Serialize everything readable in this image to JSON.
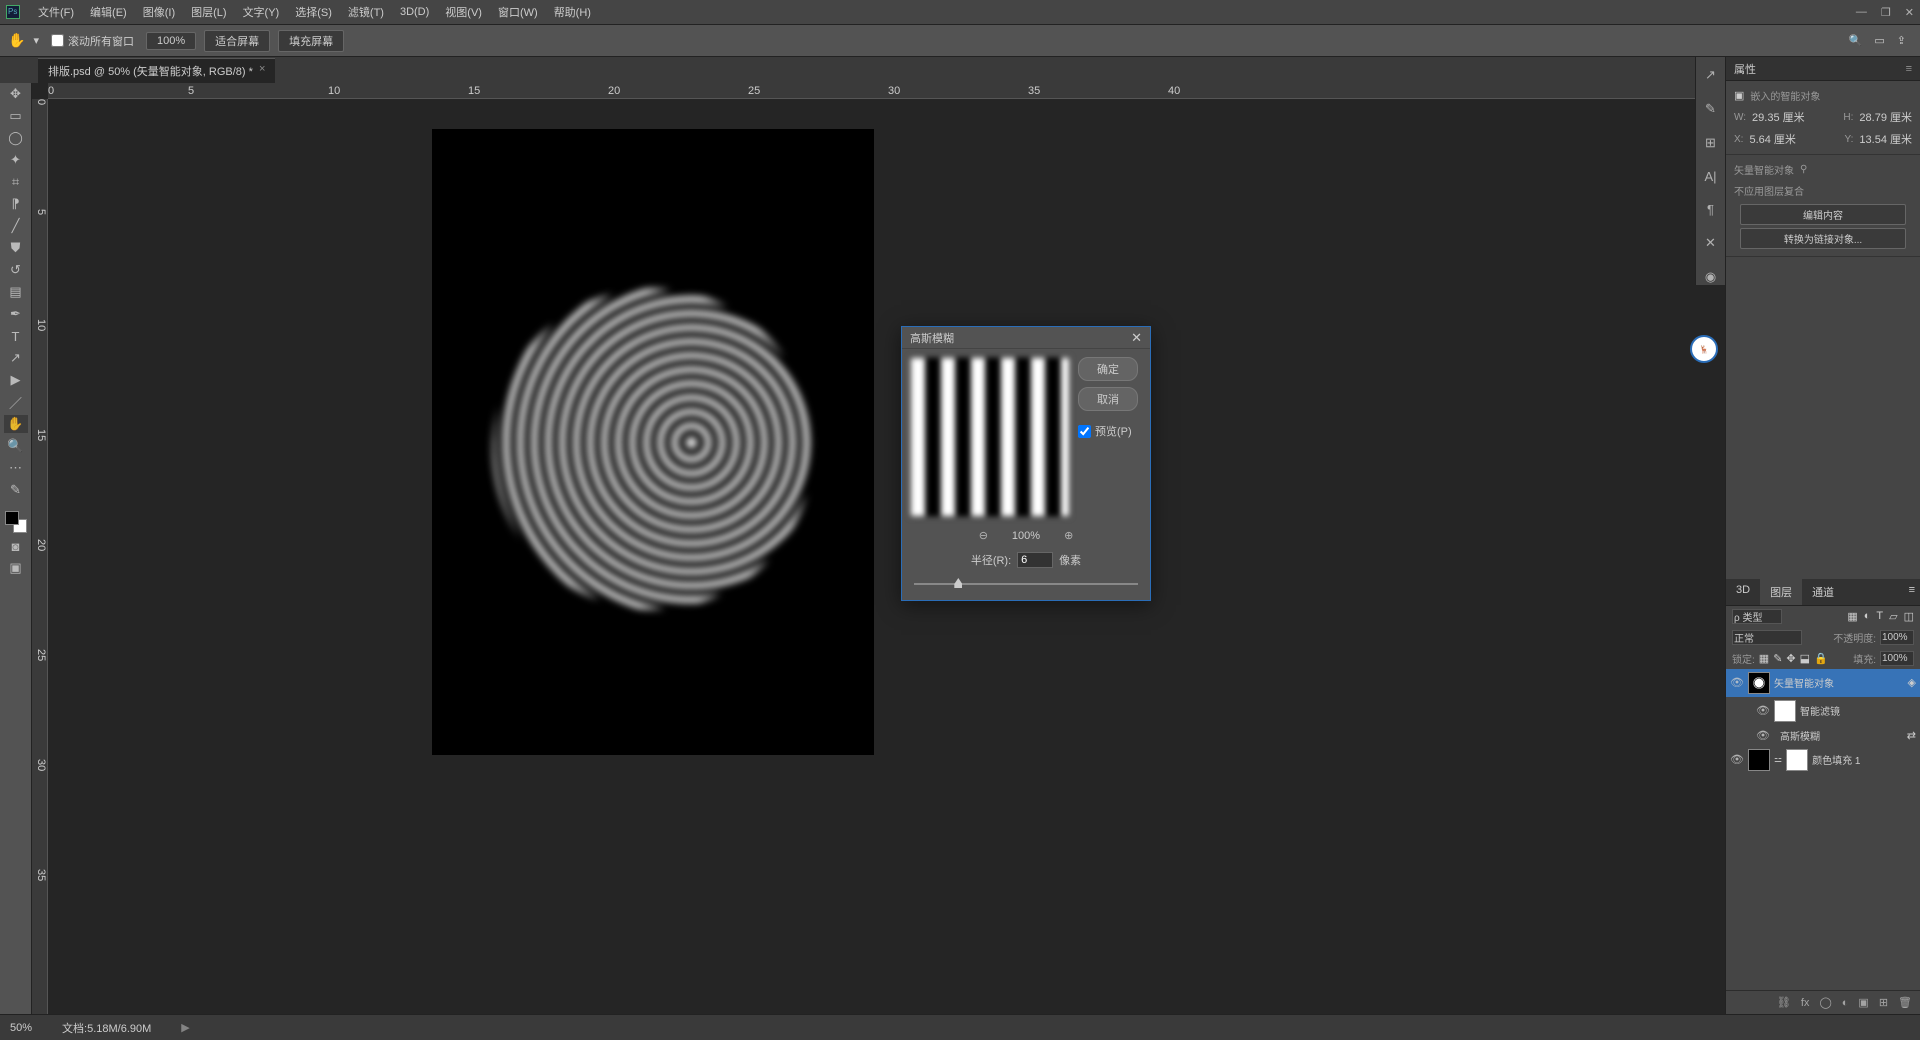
{
  "menu": {
    "items": [
      "文件(F)",
      "编辑(E)",
      "图像(I)",
      "图层(L)",
      "文字(Y)",
      "选择(S)",
      "滤镜(T)",
      "3D(D)",
      "视图(V)",
      "窗口(W)",
      "帮助(H)"
    ]
  },
  "optbar": {
    "scroll_all": "滚动所有窗口",
    "zoom": "100%",
    "fit": "适合屏幕",
    "fill": "填充屏幕"
  },
  "tab": {
    "title": "排版.psd @ 50% (矢量智能对象, RGB/8) *"
  },
  "status": {
    "zoom": "50%",
    "doc": "文档:5.18M/6.90M"
  },
  "props": {
    "title": "属性",
    "so_label": "嵌入的智能对象",
    "w_lbl": "W:",
    "w": "29.35 厘米",
    "h_lbl": "H:",
    "h": "28.79 厘米",
    "x_lbl": "X:",
    "x": "5.64 厘米",
    "y_lbl": "Y:",
    "y": "13.54 厘米",
    "vso": "矢量智能对象",
    "noncomp": "不应用图层复合",
    "edit": "编辑内容",
    "convert": "转换为链接对象..."
  },
  "layers": {
    "tabs": [
      "3D",
      "图层",
      "通道"
    ],
    "filter_lbl": "ρ 类型",
    "blend": "正常",
    "opac_lbl": "不透明度:",
    "opac": "100%",
    "lock_lbl": "锁定:",
    "fill_lbl": "填充:",
    "fill": "100%",
    "items": [
      {
        "name": "矢量智能对象",
        "sel": true,
        "eye": true
      },
      {
        "name": "智能滤镜",
        "indent": true,
        "thumb": "wht",
        "eye": true
      },
      {
        "name": "高斯模糊",
        "indent": true,
        "noThumb": true,
        "eye": true
      },
      {
        "name": "颜色填充 1",
        "thumb": "blk",
        "mask": true,
        "eye": true
      }
    ]
  },
  "dialog": {
    "title": "高斯模糊",
    "ok": "确定",
    "cancel": "取消",
    "preview": "预览(P)",
    "zoom": "100%",
    "radius_lbl": "半径(R):",
    "radius": "6",
    "unit": "像素"
  },
  "ruler_h": [
    "0",
    "5",
    "10",
    "15",
    "20",
    "25",
    "30",
    "35",
    "40"
  ],
  "ruler_v": [
    "0",
    "5",
    "10",
    "15",
    "20",
    "25",
    "30",
    "35"
  ]
}
